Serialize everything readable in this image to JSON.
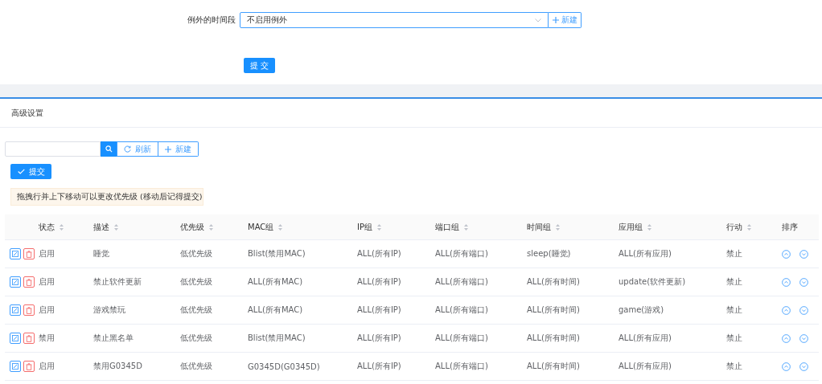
{
  "exception": {
    "label": "例外的时间段",
    "value": "不启用例外",
    "new_button": "新建",
    "submit_button": "提 交"
  },
  "advanced": {
    "title": "高级设置",
    "refresh_button": "刷新",
    "new_button": "新建",
    "submit_button": "提交",
    "hint": "拖拽行并上下移动可以更改优先级 (移动后记得提交)"
  },
  "table": {
    "columns": [
      {
        "label": "状态",
        "sortable": true
      },
      {
        "label": "描述",
        "sortable": true
      },
      {
        "label": "优先级",
        "sortable": true
      },
      {
        "label": "MAC组",
        "sortable": true
      },
      {
        "label": "IP组",
        "sortable": true
      },
      {
        "label": "端口组",
        "sortable": true
      },
      {
        "label": "时间组",
        "sortable": true
      },
      {
        "label": "应用组",
        "sortable": true
      },
      {
        "label": "行动",
        "sortable": true
      },
      {
        "label": "排序",
        "sortable": false
      }
    ],
    "rows": [
      [
        "启用",
        "睡觉",
        "低优先级",
        "Blist(禁用MAC)",
        "ALL(所有IP)",
        "ALL(所有端口)",
        "sleep(睡觉)",
        "ALL(所有应用)",
        "禁止"
      ],
      [
        "启用",
        "禁止软件更新",
        "低优先级",
        "ALL(所有MAC)",
        "ALL(所有IP)",
        "ALL(所有端口)",
        "ALL(所有时间)",
        "update(软件更新)",
        "禁止"
      ],
      [
        "启用",
        "游戏禁玩",
        "低优先级",
        "ALL(所有MAC)",
        "ALL(所有IP)",
        "ALL(所有端口)",
        "ALL(所有时间)",
        "game(游戏)",
        "禁止"
      ],
      [
        "禁用",
        "禁止黑名单",
        "低优先级",
        "Blist(禁用MAC)",
        "ALL(所有IP)",
        "ALL(所有端口)",
        "ALL(所有时间)",
        "ALL(所有应用)",
        "禁止"
      ],
      [
        "启用",
        "禁用G0345D",
        "低优先级",
        "G0345D(G0345D)",
        "ALL(所有IP)",
        "ALL(所有端口)",
        "ALL(所有时间)",
        "ALL(所有应用)",
        "禁止"
      ]
    ]
  }
}
